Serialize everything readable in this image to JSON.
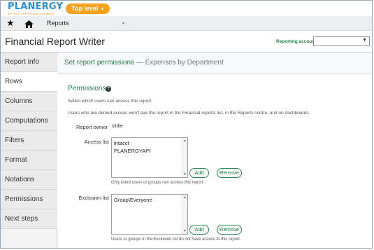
{
  "brand": {
    "logo_text": "PLANERGY",
    "tagline": "BETTER SPEND MANAGEMENT",
    "separator": "-",
    "level_pill": "Top level"
  },
  "nav": {
    "current": "Reports"
  },
  "title_bar": {
    "title": "Financial Report Writer",
    "reporting_accounts_label": "Reporting accounts",
    "reporting_accounts_value": ""
  },
  "sidebar": {
    "items": [
      {
        "label": "Report info",
        "active": false
      },
      {
        "label": "Rows",
        "active": true
      },
      {
        "label": "Columns",
        "active": false
      },
      {
        "label": "Computations",
        "active": false
      },
      {
        "label": "Filters",
        "active": false
      },
      {
        "label": "Format",
        "active": false
      },
      {
        "label": "Notations",
        "active": false
      },
      {
        "label": "Permissions",
        "active": false
      },
      {
        "label": "Next steps",
        "active": false
      }
    ]
  },
  "content": {
    "header_title": "Set report permissions",
    "header_subtitle": "— Expenses by Department",
    "section_title": "Permissions",
    "hint_select": "Select which users can access this report.",
    "hint_denied": "Users who are denied access won't see the report in the Financial reports list, in the Reports centre, and on dashboards.",
    "owner_label": "Report owner",
    "owner_value": "slittle",
    "access": {
      "label": "Access list",
      "items": [
        "intacct",
        "PLANERGYAPI"
      ],
      "add": "Add",
      "remove": "Remove",
      "note": "Only listed users or groups can access this report."
    },
    "exclusion": {
      "label": "Exclusion list",
      "items": [
        "Group\\Everyone"
      ],
      "add": "Add",
      "remove": "Remove",
      "note": "Users or groups in the Exclusion list do not have access to this report."
    }
  },
  "colors": {
    "brand_blue": "#2a8fd6",
    "pill_orange": "#f6a21e",
    "accent_green": "#2a7a4b"
  }
}
